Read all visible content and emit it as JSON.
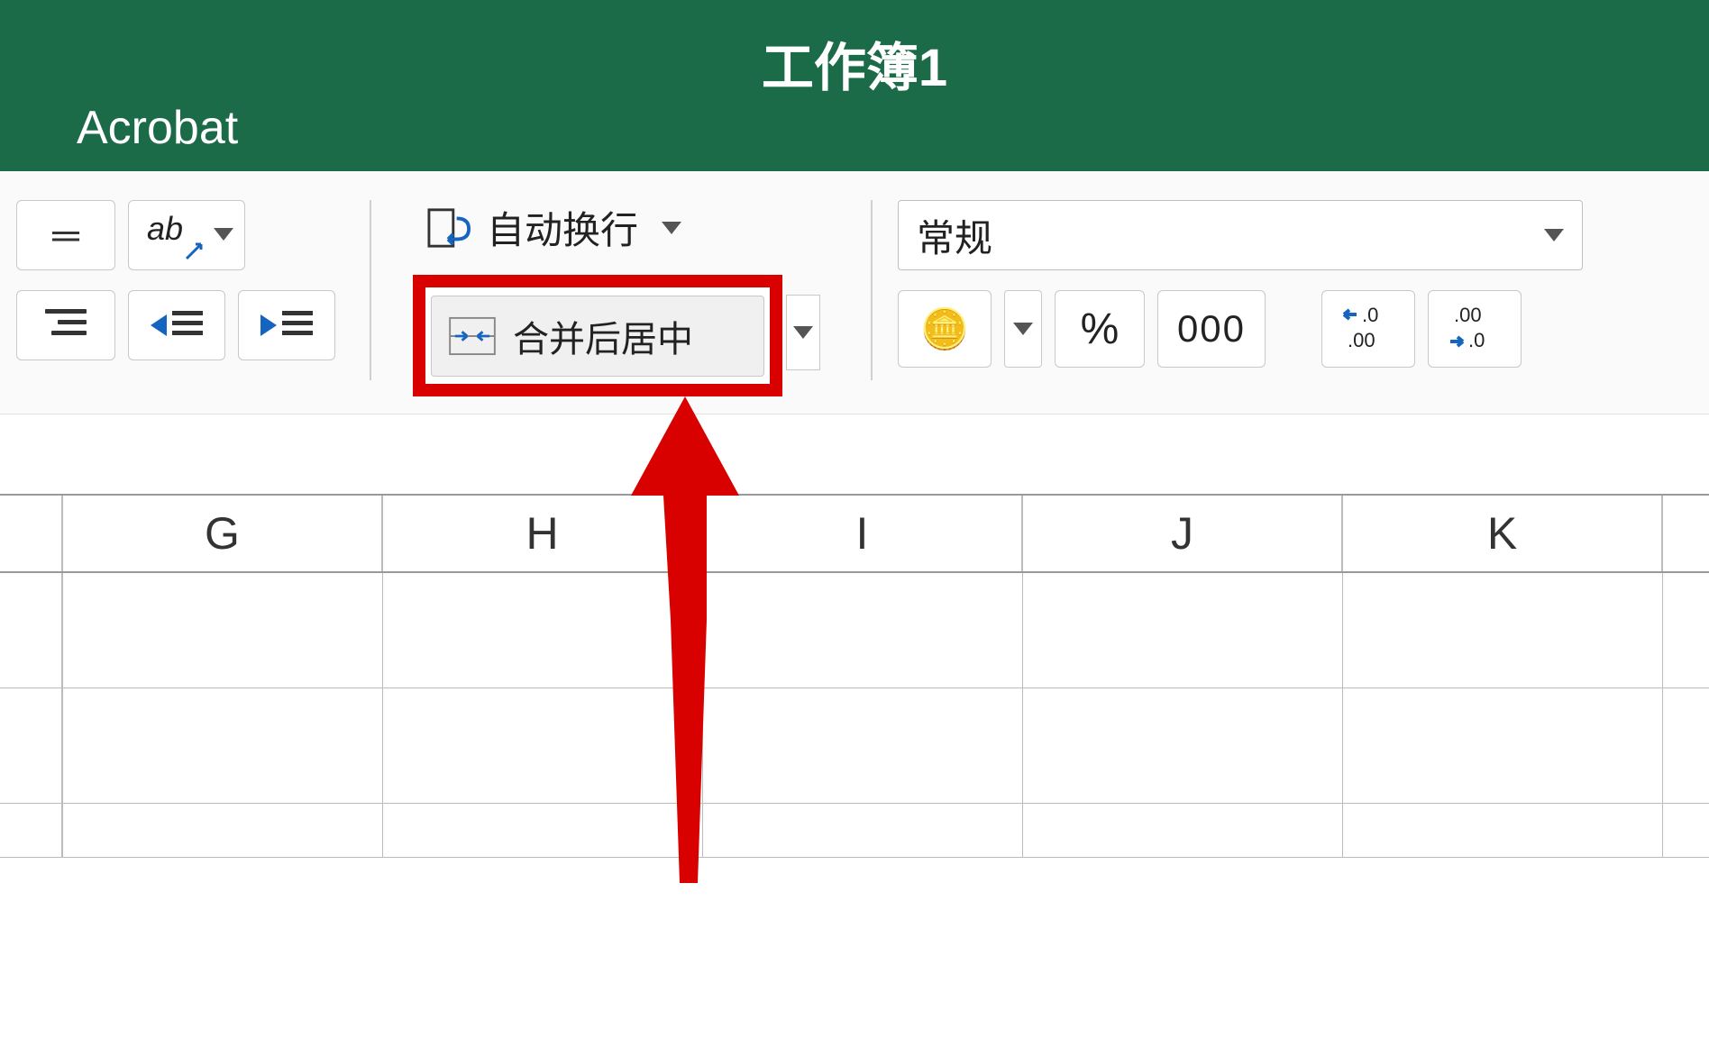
{
  "title": {
    "workbook": "工作簿1",
    "tab_acrobat": "Acrobat"
  },
  "ribbon": {
    "wrap_text_label": "自动换行",
    "merge_center_label": "合并后居中",
    "number_format_selected": "常规",
    "percent_label": "%",
    "thousands_label": "000",
    "inc_decimal_top": "←.0",
    "inc_decimal_bot": ".00",
    "dec_decimal_top": ".00",
    "dec_decimal_bot": "→.0"
  },
  "columns": [
    "G",
    "H",
    "I",
    "J",
    "K"
  ],
  "annotation": {
    "target": "merge-center-button",
    "type": "highlight-arrow"
  }
}
